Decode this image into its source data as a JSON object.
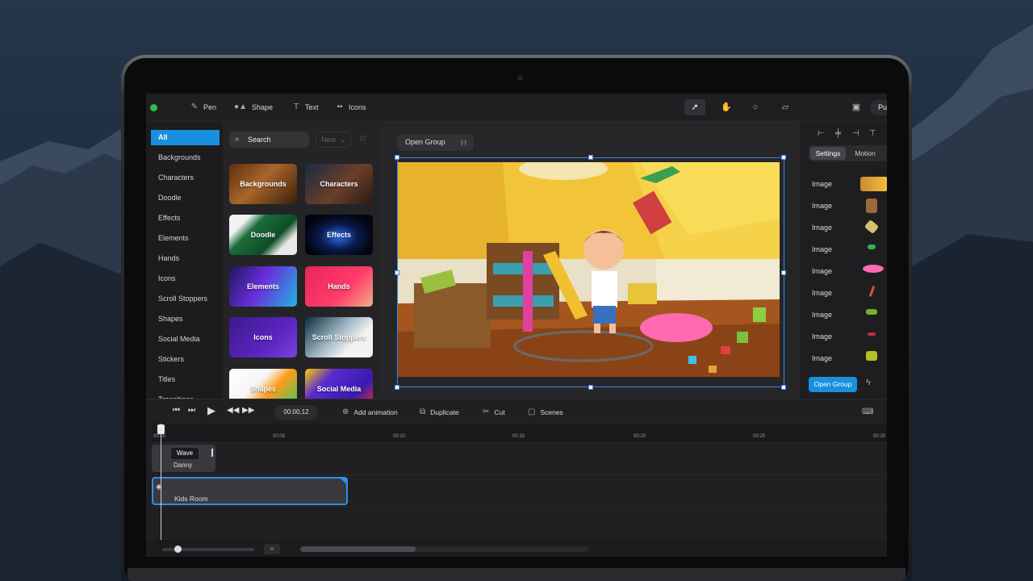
{
  "toolbar": {
    "tools": [
      {
        "label": "Pen",
        "icon": "pen-icon"
      },
      {
        "label": "Shape",
        "icon": "shape-icon"
      },
      {
        "label": "Text",
        "icon": "text-icon"
      },
      {
        "label": "Icons",
        "icon": "grid-icon"
      }
    ],
    "right_tools": [
      "pointer-icon",
      "hand-icon",
      "search-icon",
      "ruler-icon",
      "save-icon"
    ],
    "publish_label": "Pu",
    "status_color": "#2fbf4a"
  },
  "categories": {
    "items": [
      "All",
      "Backgrounds",
      "Characters",
      "Doodle",
      "Effects",
      "Elements",
      "Hands",
      "Icons",
      "Scroll Stoppers",
      "Shapes",
      "Social Media",
      "Stickers",
      "Titles",
      "Transitions"
    ],
    "selected": "All"
  },
  "assets": {
    "search_placeholder": "Search",
    "filter_label": "New",
    "tiles": [
      "Backgrounds",
      "Characters",
      "Doodle",
      "Effects",
      "Elements",
      "Hands",
      "Icons",
      "Scroll Stoppers",
      "Shapes",
      "Social Media"
    ]
  },
  "canvas": {
    "open_group_label": "Open Group"
  },
  "right_panel": {
    "tabs": [
      "Settings",
      "Motion"
    ],
    "active_tab": "Settings",
    "layers": [
      "Image",
      "Image",
      "Image",
      "Image",
      "Image",
      "Image",
      "Image",
      "Image",
      "Image"
    ],
    "open_group_label": "Open Group"
  },
  "timeline": {
    "time": "00:00,12",
    "actions": [
      "Add animation",
      "Duplicate",
      "Cut",
      "Scenes"
    ],
    "ticks": [
      "00:00",
      "00:05",
      "00:10",
      "00:15",
      "00:20",
      "00:25",
      "00:30"
    ],
    "clips": [
      {
        "badge": "Wave",
        "name": "Danny"
      },
      {
        "name": "Kids Room"
      }
    ]
  },
  "colors": {
    "accent": "#1a8fe0",
    "selection": "#3a86e8"
  }
}
